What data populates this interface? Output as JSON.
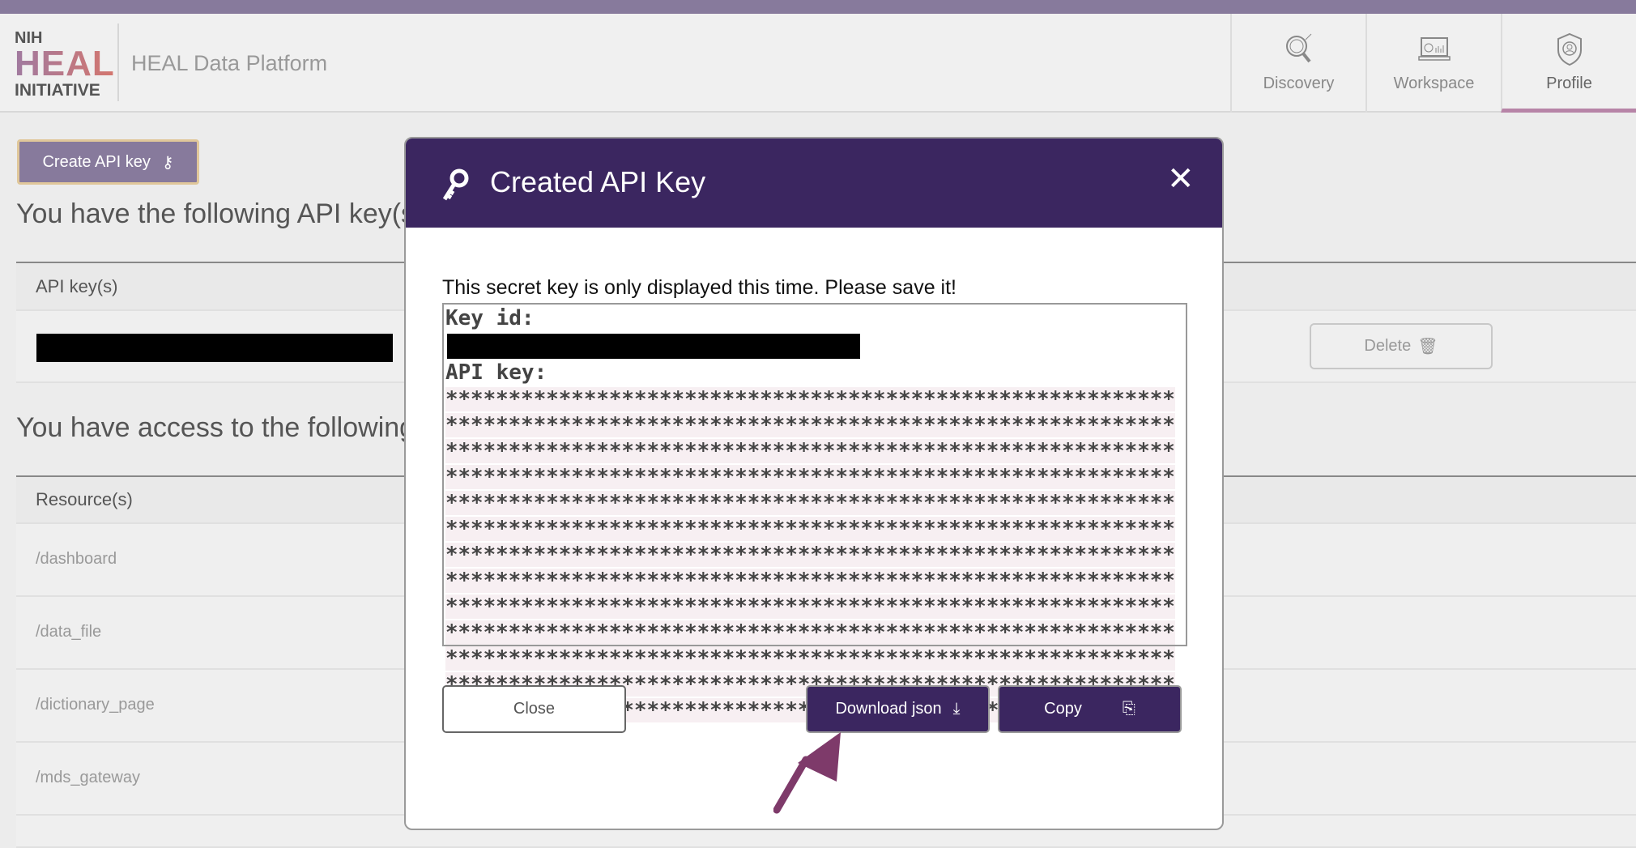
{
  "header": {
    "logo": {
      "line1": "NIH",
      "line2": "HEAL",
      "line3": "INITIATIVE"
    },
    "platform_title": "HEAL Data Platform",
    "nav": [
      {
        "label": "Discovery",
        "icon": "discovery-icon"
      },
      {
        "label": "Workspace",
        "icon": "workspace-icon"
      },
      {
        "label": "Profile",
        "icon": "profile-icon",
        "active": true
      }
    ]
  },
  "profile": {
    "create_button": "Create API key",
    "keys_heading": "You have the following API key(s)",
    "keys_column": "API key(s)",
    "delete_button": "Delete",
    "resources_heading": "You have access to the following resource(s)",
    "resources_column": "Resource(s)",
    "resources": [
      "/dashboard",
      "/data_file",
      "/dictionary_page",
      "/mds_gateway"
    ]
  },
  "modal": {
    "title": "Created API Key",
    "message": "This secret key is only displayed this time. Please save it!",
    "key_id_label": "Key id:",
    "api_key_label": "API key:",
    "api_key_masked": "*****************************************************************************************************************************************************************************************************************************************************************************************************************************************************************************************************************************************************************************************************************************************************************************************************************************************************************************************************************************************************************************",
    "close_button": "Close",
    "download_button": "Download json",
    "copy_button": "Copy"
  },
  "colors": {
    "brand": "#877a9c",
    "modal_header": "#3b2660",
    "accent": "#b784a7",
    "arrow": "#7e3a6a"
  }
}
